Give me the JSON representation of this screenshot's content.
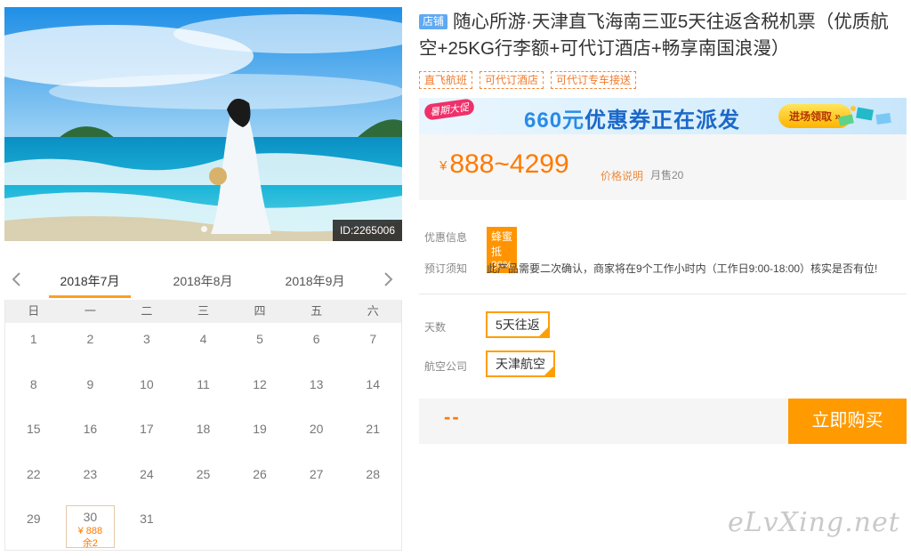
{
  "product": {
    "shop_badge": "店铺",
    "title": "随心所游·天津直飞海南三亚5天往返含税机票（优质航空+25KG行李额+可代订酒店+畅享南国浪漫）",
    "image_id": "ID:2265006",
    "tags": [
      "直飞航班",
      "可代订酒店",
      "可代订专车接送"
    ]
  },
  "promo": {
    "flag": "暑期大促",
    "amount": "660元",
    "text": "优惠券正在派发",
    "button": "进场领取 »"
  },
  "price": {
    "currency": "¥",
    "range": "888~4299",
    "explain_link": "价格说明",
    "monthly_sales": "月售20"
  },
  "info": {
    "discount_label": "优惠信息",
    "discount_badge": "蜂蜜抵30%",
    "notice_label": "预订须知",
    "notice_text": "此产品需要二次确认，商家将在9个工作小时内（工作日9:00-18:00）核实是否有位!"
  },
  "options": {
    "days_label": "天数",
    "days_value": "5天往返",
    "airline_label": "航空公司",
    "airline_value": "天津航空"
  },
  "buy": {
    "total": "--",
    "button": "立即购买"
  },
  "calendar": {
    "months": [
      "2018年7月",
      "2018年8月",
      "2018年9月"
    ],
    "active_month": 0,
    "weekdays": [
      "日",
      "一",
      "二",
      "三",
      "四",
      "五",
      "六"
    ],
    "days": [
      {
        "d": "1"
      },
      {
        "d": "2"
      },
      {
        "d": "3"
      },
      {
        "d": "4"
      },
      {
        "d": "5"
      },
      {
        "d": "6"
      },
      {
        "d": "7"
      },
      {
        "d": "8"
      },
      {
        "d": "9"
      },
      {
        "d": "10"
      },
      {
        "d": "11"
      },
      {
        "d": "12"
      },
      {
        "d": "13"
      },
      {
        "d": "14"
      },
      {
        "d": "15"
      },
      {
        "d": "16"
      },
      {
        "d": "17"
      },
      {
        "d": "18"
      },
      {
        "d": "19"
      },
      {
        "d": "20"
      },
      {
        "d": "21"
      },
      {
        "d": "22"
      },
      {
        "d": "23"
      },
      {
        "d": "24"
      },
      {
        "d": "25"
      },
      {
        "d": "26"
      },
      {
        "d": "27"
      },
      {
        "d": "28"
      },
      {
        "d": "29"
      },
      {
        "d": "30",
        "price": "¥ 888",
        "stock": "余2"
      },
      {
        "d": "31"
      }
    ]
  },
  "watermark": "eLvXing.net"
}
